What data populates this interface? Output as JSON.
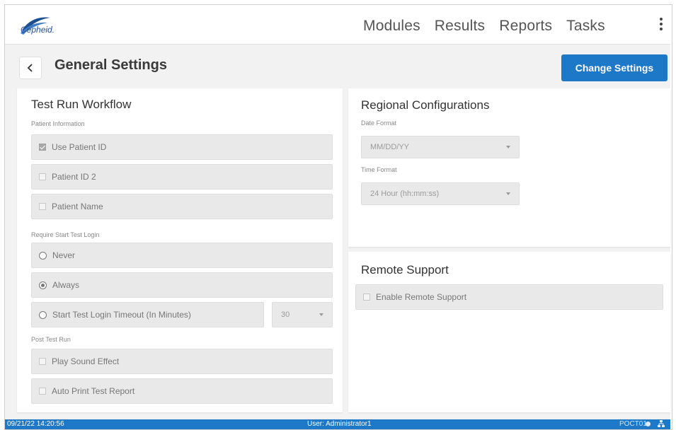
{
  "brand": {
    "logo_text": "Cepheid."
  },
  "nav": {
    "items": [
      "Modules",
      "Results",
      "Reports",
      "Tasks"
    ]
  },
  "header": {
    "title": "General Settings",
    "change_settings_label": "Change Settings"
  },
  "test_run_workflow": {
    "title": "Test Run Workflow",
    "patient_info_label": "Patient Information",
    "patient_options": [
      {
        "label": "Use Patient ID",
        "checked": true
      },
      {
        "label": "Patient ID 2",
        "checked": false
      },
      {
        "label": "Patient Name",
        "checked": false
      }
    ],
    "login_label": "Require Start Test Login",
    "login_options": [
      {
        "label": "Never",
        "selected": false
      },
      {
        "label": "Always",
        "selected": true
      },
      {
        "label": "Start Test Login Timeout (In Minutes)",
        "selected": false
      }
    ],
    "timeout_value": "30",
    "post_run_label": "Post Test Run",
    "post_run_options": [
      {
        "label": "Play Sound Effect",
        "checked": false
      },
      {
        "label": "Auto Print Test Report",
        "checked": false
      }
    ]
  },
  "regional": {
    "title": "Regional Configurations",
    "date_format_label": "Date Format",
    "date_format_value": "MM/DD/YY",
    "time_format_label": "Time Format",
    "time_format_value": "24 Hour (hh:mm:ss)"
  },
  "remote_support": {
    "title": "Remote Support",
    "option_label": "Enable Remote Support",
    "checked": false
  },
  "status_bar": {
    "datetime": "09/21/22 14:20:56",
    "user": "User: Administrator1",
    "host": "POCT01"
  },
  "colors": {
    "accent": "#1d78c8",
    "brand": "#1d4f91"
  }
}
